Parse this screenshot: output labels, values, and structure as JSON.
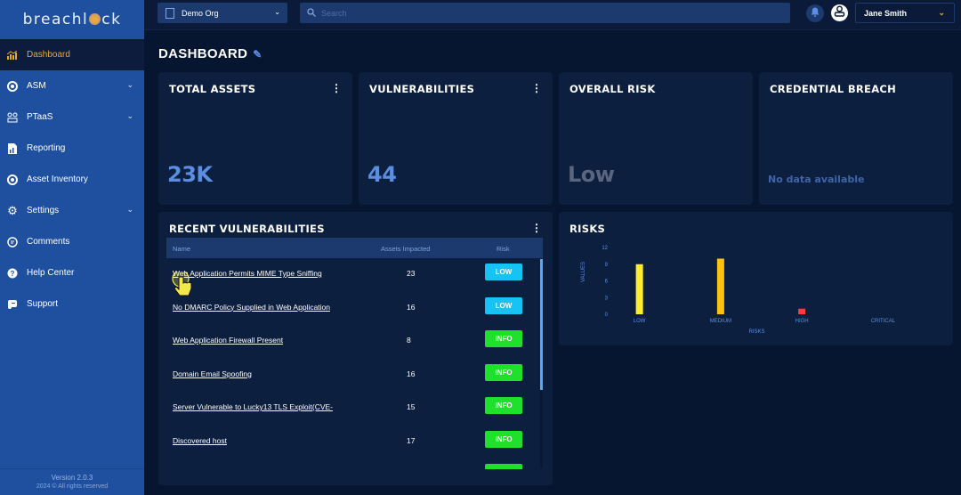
{
  "sidebar": {
    "logo": "breachlock",
    "items": [
      {
        "label": "Dashboard",
        "icon": "chart-icon",
        "active": true
      },
      {
        "label": "ASM",
        "icon": "target-icon",
        "expandable": true
      },
      {
        "label": "PTaaS",
        "icon": "users-icon",
        "expandable": true
      },
      {
        "label": "Reporting",
        "icon": "report-icon"
      },
      {
        "label": "Asset Inventory",
        "icon": "target-icon"
      },
      {
        "label": "Settings",
        "icon": "gear-icon",
        "expandable": true
      },
      {
        "label": "Comments",
        "icon": "comment-icon"
      },
      {
        "label": "Help Center",
        "icon": "help-icon"
      },
      {
        "label": "Support",
        "icon": "support-icon"
      }
    ],
    "version": "Version 2.0.3",
    "copyright": "2024 © All rights reserved"
  },
  "topbar": {
    "org": "Demo Org",
    "search_placeholder": "Search",
    "user": "Jane Smith"
  },
  "page": {
    "title": "DASHBOARD"
  },
  "cards": {
    "total_assets": {
      "title": "TOTAL ASSETS",
      "value": "23K"
    },
    "vulnerabilities": {
      "title": "VULNERABILITIES",
      "value": "44"
    },
    "overall_risk": {
      "title": "OVERALL RISK",
      "value": "Low"
    },
    "credential_breach": {
      "title": "CREDENTIAL BREACH",
      "value": "No data available"
    }
  },
  "recent": {
    "title": "RECENT VULNERABILITIES",
    "columns": [
      "Name",
      "Assets Impacted",
      "Risk"
    ],
    "rows": [
      {
        "name": "Web Application Permits MIME Type Sniffing",
        "assets": "23",
        "risk": "LOW"
      },
      {
        "name": "No DMARC Policy Supplied in Web Application",
        "assets": "16",
        "risk": "LOW"
      },
      {
        "name": "Web Application Firewall Present",
        "assets": "8",
        "risk": "INFO"
      },
      {
        "name": "Domain Email Spoofing",
        "assets": "16",
        "risk": "INFO"
      },
      {
        "name": "Server Vulnerable to Lucky13 TLS Exploit(CVE-",
        "assets": "15",
        "risk": "INFO"
      },
      {
        "name": "Discovered host",
        "assets": "17",
        "risk": "INFO"
      },
      {
        "name": "",
        "assets": "",
        "risk": "INFO"
      }
    ],
    "risk_colors": {
      "LOW": "#17c2f5",
      "INFO": "#1fe02a"
    },
    "scroll_fraction": 0.62
  },
  "risks": {
    "title": "RISKS"
  },
  "chart_data": {
    "type": "bar",
    "title": "RISKS",
    "categories": [
      "LOW",
      "MEDIUM",
      "HIGH",
      "CRITICAL"
    ],
    "values": [
      9,
      10,
      1,
      0
    ],
    "colors": [
      "#ffee30",
      "#ffc20e",
      "#ff3b3b",
      "#888888"
    ],
    "xlabel": "RISKS",
    "ylabel": "VALUES",
    "ylim": [
      0,
      12
    ],
    "yticks": [
      0,
      3,
      6,
      9,
      12
    ],
    "grid": false,
    "legend": "none"
  }
}
